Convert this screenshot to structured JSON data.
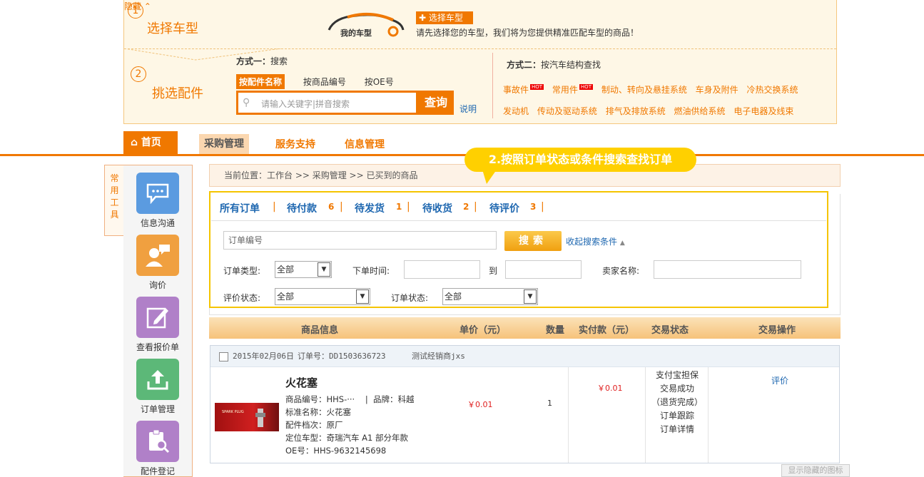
{
  "selector": {
    "step1_num": "1",
    "step1_title": "选择车型",
    "my_car": "我的车型",
    "select_car_button": "选择车型",
    "select_car_prompt": "请先选择您的车型，我们将为您提供精准匹配车型的商品！",
    "hide_link": "隐藏",
    "step2_num": "2",
    "step2_title": "挑选配件",
    "mode1_label": "方式一：",
    "mode1_value": "搜索",
    "search_tabs": [
      "按配件名称",
      "按商品编号",
      "按OE号"
    ],
    "search_placeholder": "请输入关键字|拼音搜索",
    "search_button": "查询",
    "help_link": "说明",
    "mode2_label": "方式二：",
    "mode2_value": "按汽车结构查找",
    "hot_badge": "HOT",
    "cat_row1": [
      "事故件",
      "常用件",
      "制动、转向及悬挂系统",
      "车身及附件",
      "冷热交换系统"
    ],
    "cat_row2": [
      "发动机",
      "传动及驱动系统",
      "排气及排放系统",
      "燃油供给系统",
      "电子电器及线束"
    ]
  },
  "nav": {
    "home": "首页",
    "items": [
      "采购管理",
      "服务支持",
      "信息管理"
    ]
  },
  "sidebar": {
    "tab_label": "常用工具",
    "tools": [
      {
        "label": "信息沟通",
        "color": "#5b9be0"
      },
      {
        "label": "询价",
        "color": "#f0a040"
      },
      {
        "label": "查看报价单",
        "color": "#b080c8"
      },
      {
        "label": "订单管理",
        "color": "#5cb878"
      },
      {
        "label": "配件登记",
        "color": "#b080c8"
      }
    ]
  },
  "breadcrumb": "当前位置：工作台 >> 采购管理 >> 已买到的商品",
  "callout": "2.按照订单状态或条件搜索查找订单",
  "status_tabs": [
    {
      "label": "所有订单",
      "count": ""
    },
    {
      "label": "待付款",
      "count": "6"
    },
    {
      "label": "待发货",
      "count": "1"
    },
    {
      "label": "待收货",
      "count": "2"
    },
    {
      "label": "待评价",
      "count": "3"
    }
  ],
  "filter": {
    "order_no_placeholder": "订单编号",
    "search_button": "搜索",
    "collapse_link": "收起搜索条件",
    "order_type_label": "订单类型:",
    "order_type_value": "全部",
    "order_time_label": "下单时间:",
    "to_label": "到",
    "seller_label": "卖家名称:",
    "review_status_label": "评价状态:",
    "review_status_value": "全部",
    "order_status_label": "订单状态:",
    "order_status_value": "全部"
  },
  "table_headers": [
    "商品信息",
    "单价（元）",
    "数量",
    "实付款（元）",
    "交易状态",
    "交易操作"
  ],
  "order": {
    "date": "2015年02月06日",
    "order_no": "订单号：DD1503636723",
    "seller": "测试经销商jxs",
    "product_name": "火花塞",
    "product_code": "商品编号：HHS-···",
    "brand": "品牌：科越",
    "std_name": "标准名称：火花塞",
    "grade": "配件档次：原厂",
    "car_model": "定位车型：奇瑞汽车 A1 部分年款",
    "oe_no": "OE号：HHS-9632145698",
    "unit_price": "￥0.01",
    "quantity": "1",
    "paid": "￥0.01",
    "status_lines": [
      "支付宝担保",
      "交易成功",
      "（退货完成）",
      "订单跟踪",
      "订单详情"
    ],
    "action": "评价"
  },
  "tooltip": "显示隐藏的图标"
}
